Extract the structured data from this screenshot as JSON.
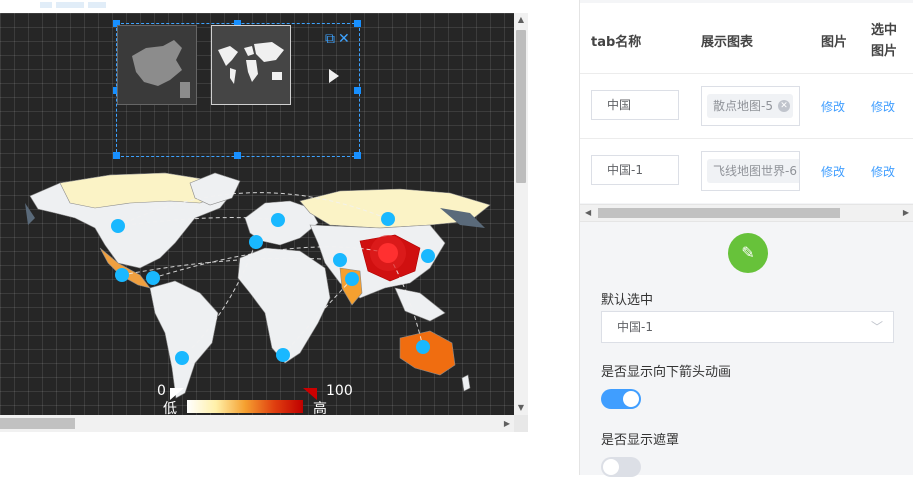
{
  "canvas": {
    "legend": {
      "min": "0",
      "max": "100",
      "low": "低",
      "high": "高"
    },
    "tab_icons": [
      "china-map-thumbnail",
      "world-map-thumbnail"
    ]
  },
  "table": {
    "headers": [
      "tab名称",
      "展示图表",
      "图片",
      "选中\n图片"
    ],
    "header_col4_line1": "选中",
    "header_col4_line2": "图片",
    "rows": [
      {
        "name": "中国",
        "chart": "散点地图-5",
        "image_link": "修改",
        "selected_image_link": "修改"
      },
      {
        "name": "中国-1",
        "chart": "飞线地图世界-6",
        "image_link": "修改",
        "selected_image_link": "修改"
      }
    ]
  },
  "settings": {
    "default_selected_label": "默认选中",
    "default_selected_value": "中国-1",
    "show_arrow_anim_label": "是否显示向下箭头动画",
    "show_arrow_anim": true,
    "show_mask_label": "是否显示遮罩",
    "show_mask": false
  },
  "colors": {
    "accent": "#409eff",
    "toggle_on": "#409eff",
    "toggle_off": "#dcdfe6",
    "edit_button": "#67c23a",
    "selection": "#1890ff"
  }
}
